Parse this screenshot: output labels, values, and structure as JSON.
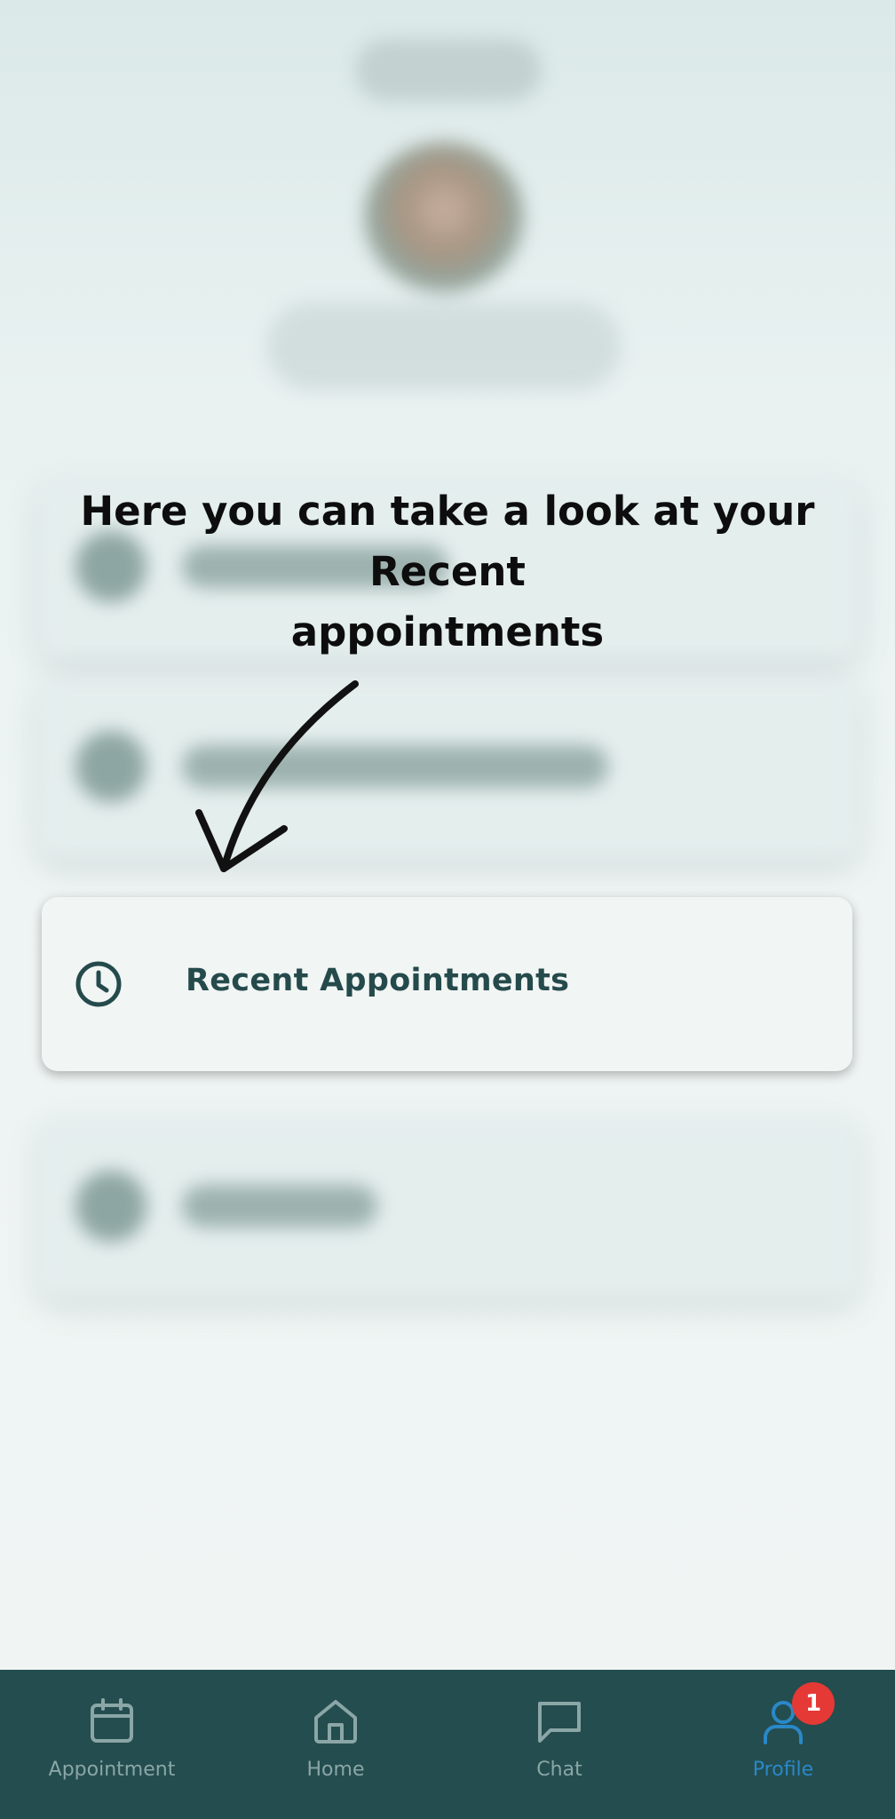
{
  "tutorial": {
    "line1": "Here you can take a look at your Recent",
    "line2": "appointments"
  },
  "highlight": {
    "label": "Recent Appointments",
    "icon": "clock-icon"
  },
  "bottom_nav": {
    "items": [
      {
        "label": "Appointment",
        "icon": "calendar-icon"
      },
      {
        "label": "Home",
        "icon": "home-icon"
      },
      {
        "label": "Chat",
        "icon": "chat-icon"
      },
      {
        "label": "Profile",
        "icon": "user-icon",
        "badge": "1",
        "active": true
      }
    ]
  },
  "colors": {
    "nav_bg": "#244d4f",
    "active": "#2a88c7",
    "inactive": "#8ba6a6",
    "badge": "#e53935",
    "card_text": "#254a4c"
  }
}
